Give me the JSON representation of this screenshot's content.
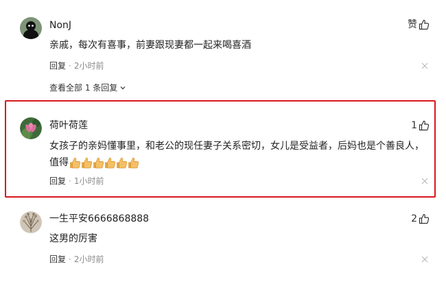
{
  "comments": [
    {
      "username": "NonJ",
      "content": "亲戚，每次有喜事，前妻跟现妻都一起来喝喜酒",
      "reply_label": "回复",
      "separator": "·",
      "time": "2小时前",
      "like_label": "赞",
      "avatar_icon": "black-figure-avatar-icon",
      "view_all": "查看全部 1 条回复"
    },
    {
      "username": "荷叶荷莲",
      "content_line1": "女孩子的亲妈懂事里，和老公的现任妻子关系密切，女儿是受益者，后妈也是个善良人，",
      "content_line2": "值得",
      "emoji_count": 6,
      "reply_label": "回复",
      "separator": "·",
      "time": "1小时前",
      "like_count": "1",
      "avatar_icon": "lotus-flower-avatar-icon"
    },
    {
      "username": "一生平安6666868888",
      "content": "这男的厉害",
      "reply_label": "回复",
      "separator": "·",
      "time": "2小时前",
      "like_count": "2",
      "avatar_icon": "dried-flowers-avatar-icon"
    }
  ],
  "colors": {
    "highlight": "#d7161f",
    "text": "#222222",
    "meta": "#8a8a8a"
  }
}
